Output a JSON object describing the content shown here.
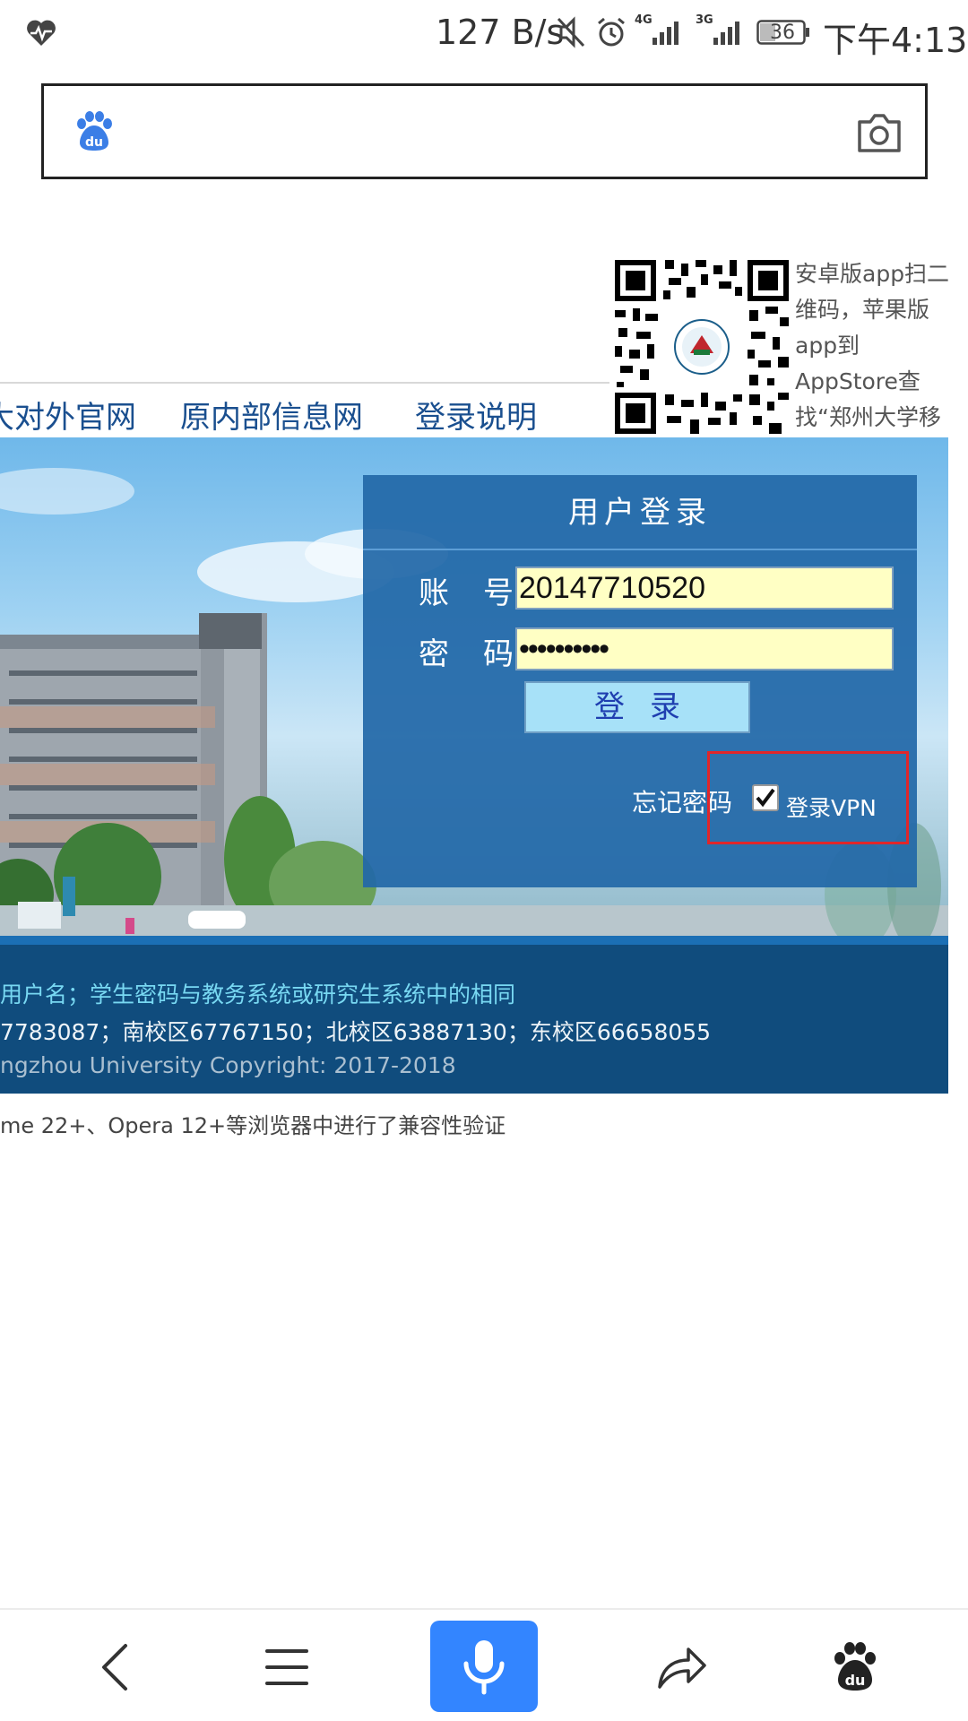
{
  "status_bar": {
    "net_speed": "127 B/s",
    "net1": "4G",
    "net2": "3G",
    "battery": "36",
    "time": "下午4:13"
  },
  "nav": {
    "links": [
      "大对外官网",
      "原内部信息网",
      "登录说明"
    ]
  },
  "qr": {
    "caption": "安卓版app扫二维码，苹果版app到AppStore查找“郑州大学移动校园”"
  },
  "login": {
    "title": "用户登录",
    "account_label": "账号",
    "account_value": "20147710520",
    "password_label": "密码",
    "password_value": "••••••••••",
    "submit_label": "登录",
    "forgot_label": "忘记密码",
    "vpn_label": "登录VPN",
    "vpn_checked": true
  },
  "footer": {
    "line1": "用户名；学生密码与教务系统或研究生系统中的相同",
    "line2": "7783087；南校区67767150；北校区63887130；东校区66658055",
    "line3": "ngzhou University Copyright: 2017-2018",
    "note": "me 22+、Opera 12+等浏览器中进行了兼容性验证"
  },
  "colors": {
    "panel": "#2268a8",
    "footer": "#104c7d",
    "input_bg": "#ffffc4",
    "button_bg": "#a7e1f8",
    "highlight": "#e0262a",
    "voice_button": "#3385ff"
  },
  "icons": [
    "heart-rate-icon",
    "mute-icon",
    "alarm-icon",
    "signal-icon",
    "battery-icon",
    "baidu-paw-icon",
    "camera-icon",
    "qr-code",
    "back-icon",
    "menu-icon",
    "microphone-icon",
    "share-icon",
    "baidu-home-icon"
  ]
}
